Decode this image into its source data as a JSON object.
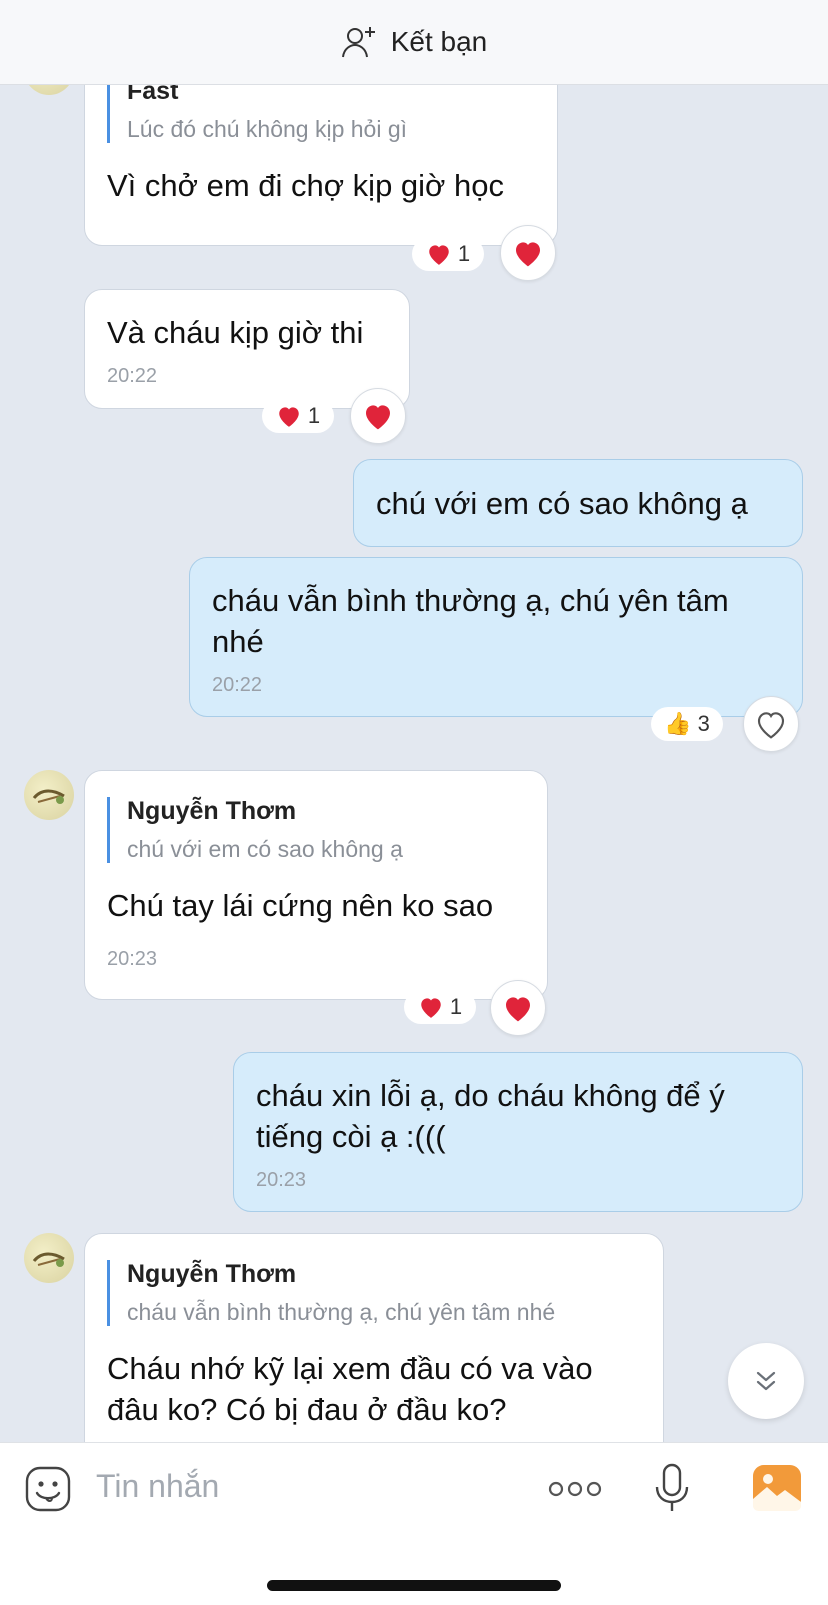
{
  "header": {
    "add_friend_label": "Kết bạn",
    "icon": "add-friend-icon"
  },
  "messages": [
    {
      "quote_name": "Fast",
      "quote_text": "Lúc đó chú không kịp hỏi gì",
      "text": "Vì chở em đi chợ kịp giờ học",
      "reaction": "heart",
      "reaction_count": "1"
    },
    {
      "text": "Và cháu kịp giờ thi",
      "time": "20:22",
      "reaction": "heart",
      "reaction_count": "1"
    },
    {
      "text": "chú với em có sao không ạ"
    },
    {
      "text_line1": "cháu vẫn bình thường ạ, chú yên tâm",
      "text_line2": "nhé",
      "time": "20:22",
      "reaction": "thumbs-up",
      "reaction_count": "3"
    },
    {
      "quote_name": "Nguyễn Thơm",
      "quote_text": "chú với em có sao không ạ",
      "text": "Chú tay lái cứng nên ko sao",
      "time": "20:23",
      "reaction": "heart",
      "reaction_count": "1"
    },
    {
      "text_line1": "cháu xin lỗi ạ, do cháu không để ý",
      "text_line2": "tiếng còi ạ :(((",
      "time": "20:23"
    },
    {
      "quote_name": "Nguyễn Thơm",
      "quote_text": "cháu vẫn bình thường ạ, chú yên tâm nhé",
      "text_line1": "Cháu nhớ kỹ lại xem đầu có va vào",
      "text_line2": "đâu ko? Có bị đau ở đầu ko?"
    }
  ],
  "composer": {
    "placeholder": "Tin nhắn"
  },
  "colors": {
    "heart": "#e0243a",
    "accent": "#4a90e2",
    "my_bubble": "#d6ecfb",
    "background": "#e3e8f0"
  }
}
